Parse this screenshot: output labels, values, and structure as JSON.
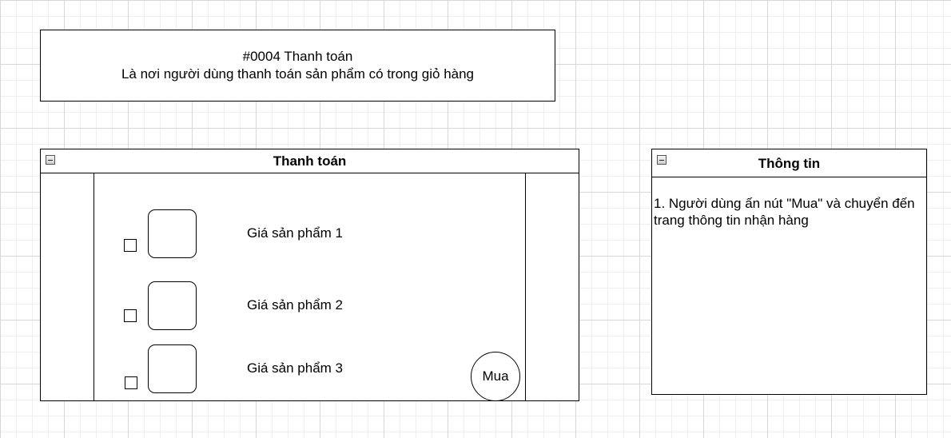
{
  "header": {
    "title": "#0004 Thanh toán",
    "description": "Là nơi người dùng thanh toán sản phẩm có trong giỏ hàng"
  },
  "payment_panel": {
    "title": "Thanh toán",
    "items": [
      {
        "price_label": "Giá sản phẩm 1"
      },
      {
        "price_label": "Giá sản phẩm 2"
      },
      {
        "price_label": "Giá sản phẩm 3"
      }
    ],
    "buy_label": "Mua"
  },
  "info_panel": {
    "title": "Thông tin",
    "text": "1. Người dùng ấn nút \"Mua\" và chuyển đến trang thông tin nhận hàng"
  }
}
